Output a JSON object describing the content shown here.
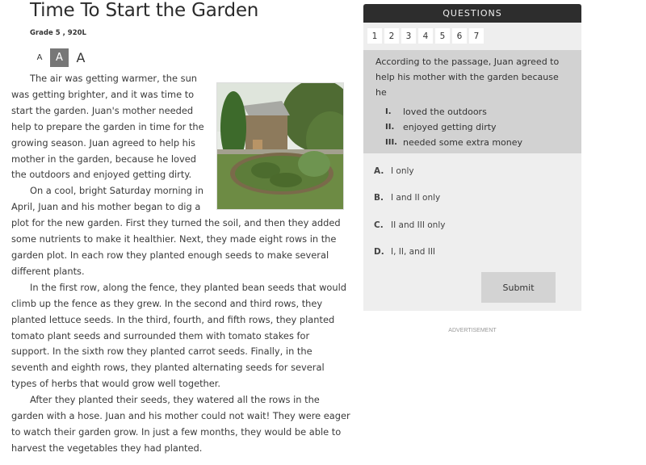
{
  "article": {
    "title": "Time To Start the Garden",
    "grade_info": "Grade 5 , 920L",
    "font_size_controls": [
      {
        "label": "A",
        "size": "small",
        "selected": false
      },
      {
        "label": "A",
        "size": "medium",
        "selected": true
      },
      {
        "label": "A",
        "size": "large",
        "selected": false
      }
    ],
    "image_alt": "garden-photo",
    "paragraphs": [
      "The air was getting warmer, the sun was getting brighter, and it was time to start the garden. Juan's mother needed help to prepare the garden in time for the growing season. Juan agreed to help his mother in the garden, because he loved the outdoors and enjoyed getting dirty.",
      "On a cool, bright Saturday morning in April, Juan and his mother began to dig a plot for the new garden. First they turned the soil, and then they added some nutrients to make it healthier. Next, they made eight rows in the garden plot. In each row they planted enough seeds to make several different plants.",
      "In the first row, along the fence, they planted bean seeds that would climb up the fence as they grew. In the second and third rows, they planted lettuce seeds. In the third, fourth, and fifth rows, they planted tomato plant seeds and surrounded them with tomato stakes for support. In the sixth row they planted carrot seeds. Finally, in the seventh and eighth rows, they planted alternating seeds for several types of herbs that would grow well together.",
      "After they planted their seeds, they watered all the rows in the garden with a hose. Juan and his mother could not wait! They were eager to watch their garden grow. In just a few months, they would be able to harvest the vegetables they had planted."
    ]
  },
  "questions": {
    "header": "QUESTIONS",
    "tabs": [
      "1",
      "2",
      "3",
      "4",
      "5",
      "6",
      "7"
    ],
    "stem": "According to the passage, Juan agreed to help his mother with the garden because he",
    "statements": [
      {
        "num": "I.",
        "text": "loved the outdoors"
      },
      {
        "num": "II.",
        "text": "enjoyed getting dirty"
      },
      {
        "num": "III.",
        "text": "needed some extra money"
      }
    ],
    "answers": [
      {
        "letter": "A.",
        "text": "I only"
      },
      {
        "letter": "B.",
        "text": "I and II only"
      },
      {
        "letter": "C.",
        "text": "II and III only"
      },
      {
        "letter": "D.",
        "text": "I, II, and III"
      }
    ],
    "submit_label": "Submit"
  },
  "advertisement_label": "ADVERTISEMENT"
}
